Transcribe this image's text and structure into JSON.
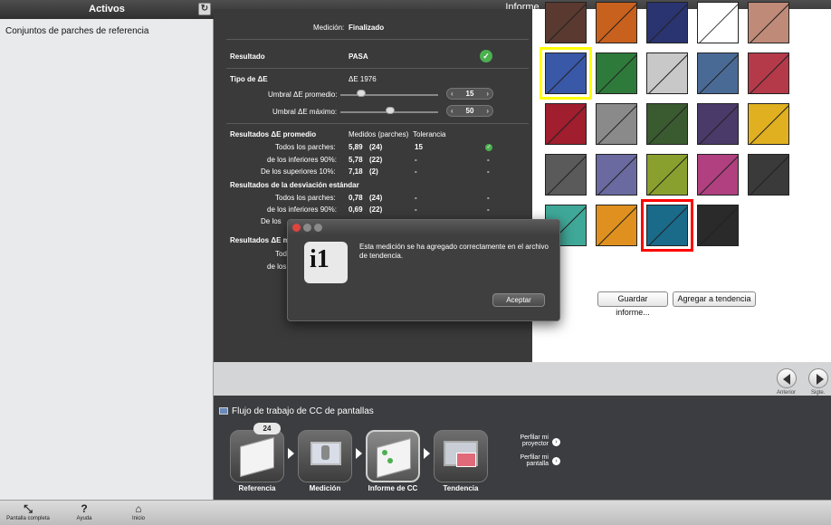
{
  "sidebar": {
    "title": "Activos",
    "refresh_icon": "↻",
    "item": "Conjuntos de parches de referencia"
  },
  "main": {
    "title": "Informe"
  },
  "results": {
    "medicion_label": "Medición:",
    "medicion_value": "Finalizado",
    "resultado_label": "Resultado",
    "resultado_value": "PASA",
    "tipo_label": "Tipo de ΔE",
    "tipo_value": "ΔE 1976",
    "umbral_prom_label": "Umbral ΔE promedio:",
    "umbral_prom_value": "15",
    "umbral_max_label": "Umbral ΔE máximo:",
    "umbral_max_value": "50",
    "avg_title": "Resultados ΔE promedio",
    "col_medidos": "Medidos (parches)",
    "col_tolerancia": "Tolerancia",
    "avg_rows": [
      {
        "label": "Todos los parches:",
        "value": "5,89",
        "count": "(24)",
        "tol": "15"
      },
      {
        "label": "de los inferiores 90%:",
        "value": "5,78",
        "count": "(22)",
        "tol": "-",
        "extra": "-"
      },
      {
        "label": "De los superiores 10%:",
        "value": "7,18",
        "count": "(2)",
        "tol": "-",
        "extra": "-"
      }
    ],
    "std_title": "Resultados de la desviación estándar",
    "std_rows": [
      {
        "label": "Todos los parches:",
        "value": "0,78",
        "count": "(24)",
        "tol": "-",
        "extra": "-"
      },
      {
        "label": "de los inferiores 90%:",
        "value": "0,69",
        "count": "(22)",
        "tol": "-",
        "extra": "-"
      },
      {
        "label": "De los",
        "tol": "-",
        "extra": "-"
      }
    ],
    "max_title": "Resultados ΔE m",
    "max_rows": [
      {
        "label": "Tod"
      },
      {
        "label": "de los"
      }
    ]
  },
  "patches": {
    "rows": [
      [
        "#5a3a30",
        "#c8601e",
        "#2a3470",
        "#ffffff",
        "#c08a78"
      ],
      [
        "#3a58a8",
        "#2e7a3a",
        "#c8c8c8",
        "#4a6a96",
        "#b43a4a"
      ],
      [
        "#a01e2e",
        "#8a8a8a",
        "#3a5a30",
        "#4a3a6a",
        "#e0b020"
      ],
      [
        "#5a5a5a",
        "#6a6aa0",
        "#8aa02e",
        "#b04080",
        "#3a3a3a"
      ],
      [
        "#40a898",
        "#e0901e",
        "#1a6a8a",
        "#2a2a2a"
      ]
    ],
    "guardar_label": "Guardar informe...",
    "tendencia_label": "Agregar a tendencia",
    "highlight_color_yellow": "#ffff00",
    "highlight_color_red": "#ff0000"
  },
  "nav": {
    "anterior": "Anterior",
    "siguiente": "Sigte."
  },
  "workflow": {
    "title": "Flujo de trabajo de CC de pantallas",
    "badge": "24",
    "steps": [
      "Referencia",
      "Medición",
      "Informe de CC",
      "Tendencia"
    ],
    "link1": "Perfilar mi proyector",
    "link2": "Perfilar mi pantalla"
  },
  "bottom": {
    "fullscreen": "Pantalla completa",
    "help": "Ayuda",
    "home": "Inicio"
  },
  "dialog": {
    "message": "Esta medición se ha agregado correctamente en el archivo de tendencia.",
    "button": "Aceptar",
    "logo": "i1"
  }
}
